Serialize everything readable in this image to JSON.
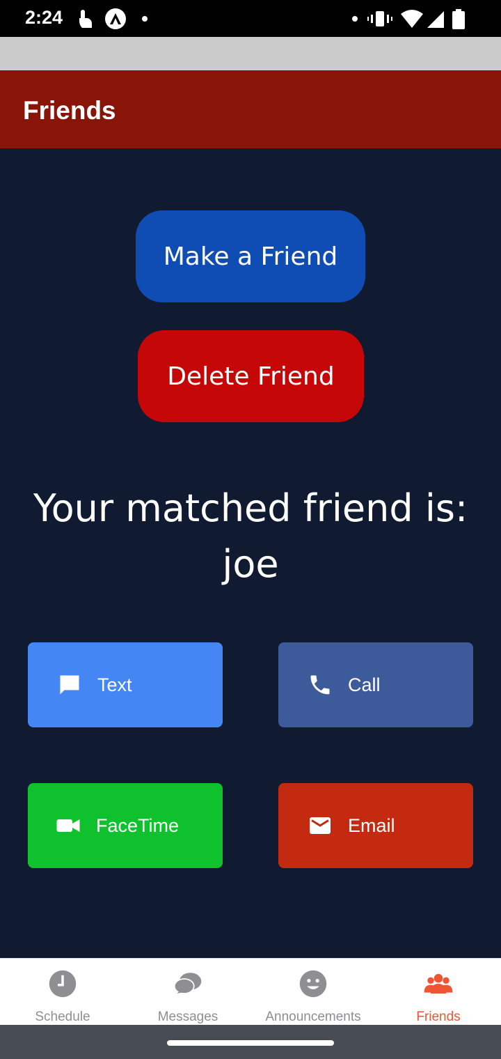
{
  "status_bar": {
    "time": "2:24",
    "left_icons": [
      "touch-icon",
      "arch-icon",
      "dot-icon"
    ],
    "right_icons": [
      "dot-icon",
      "vibrate-icon",
      "wifi-icon",
      "signal-icon",
      "battery-icon"
    ]
  },
  "header": {
    "title": "Friends",
    "color": "#891508"
  },
  "main": {
    "make_friend_label": "Make a Friend",
    "delete_friend_label": "Delete Friend",
    "match_prefix": "Your matched friend is:",
    "match_name": "joe",
    "actions": [
      {
        "label": "Text",
        "icon": "message-icon",
        "color": "#4487f4"
      },
      {
        "label": "Call",
        "icon": "phone-icon",
        "color": "#3d5a9b"
      },
      {
        "label": "FaceTime",
        "icon": "video-icon",
        "color": "#0fc22d"
      },
      {
        "label": "Email",
        "icon": "mail-icon",
        "color": "#c32a10"
      }
    ]
  },
  "tabs": [
    {
      "label": "Schedule",
      "icon": "clock-icon",
      "active": false
    },
    {
      "label": "Messages",
      "icon": "chat-bubbles-icon",
      "active": false
    },
    {
      "label": "Announcements",
      "icon": "smiley-icon",
      "active": false
    },
    {
      "label": "Friends",
      "icon": "people-icon",
      "active": true
    }
  ],
  "colors": {
    "background": "#101a30",
    "active_tab": "#f05533",
    "inactive_tab": "#8e8e93"
  }
}
